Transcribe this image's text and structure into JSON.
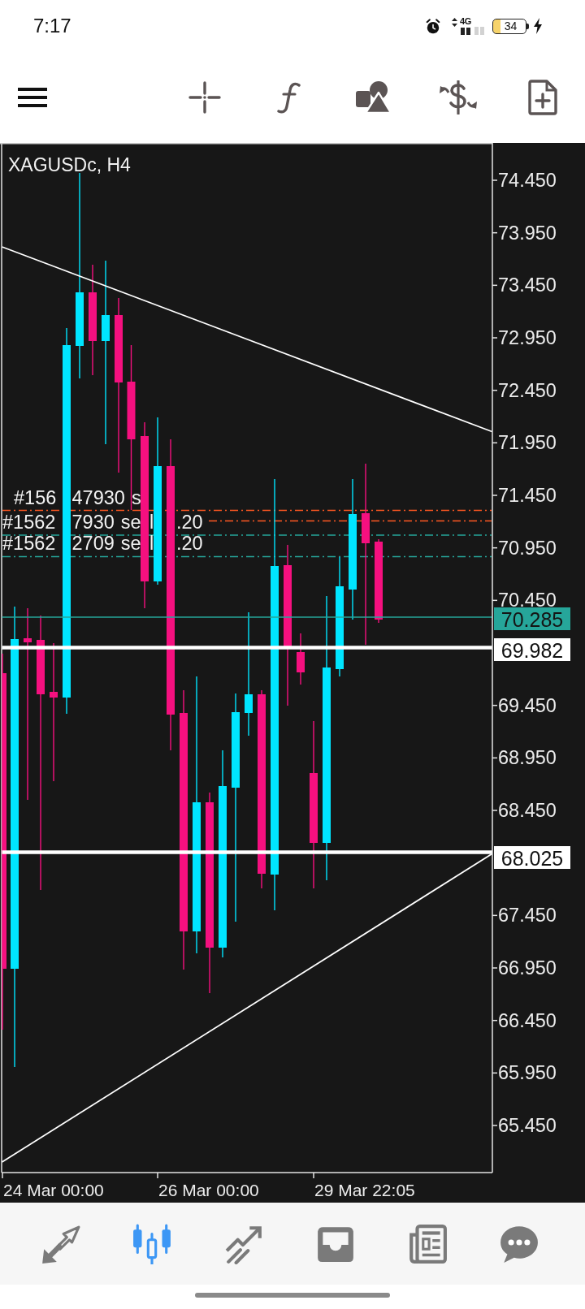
{
  "status_bar": {
    "time": "7:17",
    "network": "4G",
    "battery": "34"
  },
  "chart": {
    "title": "XAGUSDc, H4",
    "price_labels": [
      "74.450",
      "73.950",
      "73.450",
      "72.950",
      "72.450",
      "71.950",
      "71.450",
      "70.950",
      "70.450",
      "69.450",
      "68.950",
      "68.450",
      "67.450",
      "66.950",
      "66.450",
      "65.950",
      "65.450"
    ],
    "order_labels": [
      {
        "fragments": [
          "#156",
          "47930 s"
        ]
      },
      {
        "fragments": [
          "#1562",
          "7930 se",
          "l",
          ".20"
        ]
      },
      {
        "fragments": [
          "#1562",
          "2709 se",
          "l",
          ".20"
        ]
      }
    ],
    "price_tags": [
      {
        "kind": "bid",
        "text": "70.285"
      },
      {
        "kind": "level",
        "text": "69.982"
      },
      {
        "kind": "level",
        "text": "68.025"
      }
    ],
    "time_labels": [
      "24 Mar 00:00",
      "26 Mar 00:00",
      "29 Mar 22:05"
    ]
  },
  "bottom_nav": [
    {
      "selected": false
    },
    {
      "selected": true
    },
    {
      "selected": false
    },
    {
      "selected": false
    },
    {
      "selected": false
    },
    {
      "selected": false
    }
  ]
}
